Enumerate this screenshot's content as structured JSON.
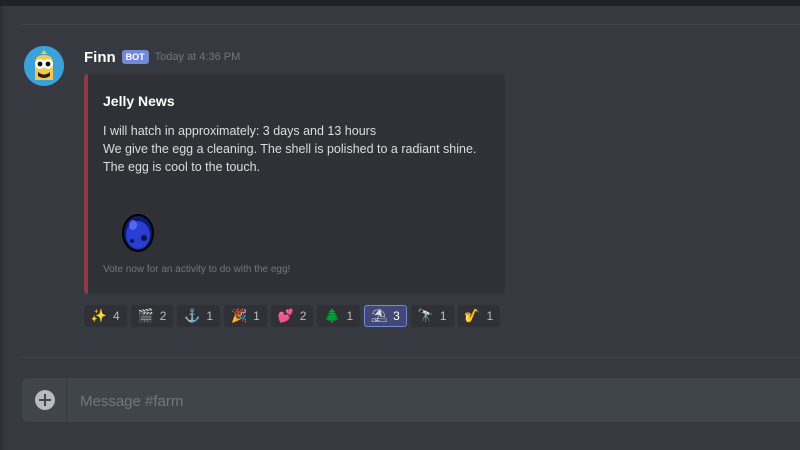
{
  "message": {
    "author": "Finn",
    "bot_tag": "BOT",
    "timestamp": "Today at 4:36 PM",
    "embed": {
      "accent_color": "#8c3b46",
      "title": "Jelly News",
      "description_lines": [
        "I will hatch in approximately: 3 days and 13 hours",
        "We give the egg a cleaning. The shell is polished to a radiant shine.",
        "The egg is cool to the touch."
      ],
      "image_icon": "egg-icon",
      "footer": "Vote now for an activity to do with the egg!"
    },
    "reactions": [
      {
        "emoji": "sparkles",
        "glyph": "✨",
        "count": "4",
        "me": false
      },
      {
        "emoji": "clapper",
        "glyph": "🎬",
        "count": "2",
        "me": false
      },
      {
        "emoji": "anchor",
        "glyph": "⚓",
        "count": "1",
        "me": false
      },
      {
        "emoji": "party-popper",
        "glyph": "🎉",
        "count": "1",
        "me": false
      },
      {
        "emoji": "hearts",
        "glyph": "💕",
        "count": "2",
        "me": false
      },
      {
        "emoji": "evergreen-tree",
        "glyph": "🌲",
        "count": "1",
        "me": false
      },
      {
        "emoji": "beach-umbrella",
        "glyph": "⛱",
        "count": "3",
        "me": true
      },
      {
        "emoji": "telescope",
        "glyph": "🔭",
        "count": "1",
        "me": false
      },
      {
        "emoji": "saxophone",
        "glyph": "🎷",
        "count": "1",
        "me": false
      }
    ]
  },
  "composer": {
    "placeholder": "Message #farm"
  },
  "colors": {
    "background": "#36393f",
    "embed_bg": "#2f3136",
    "blurple": "#7289da"
  }
}
